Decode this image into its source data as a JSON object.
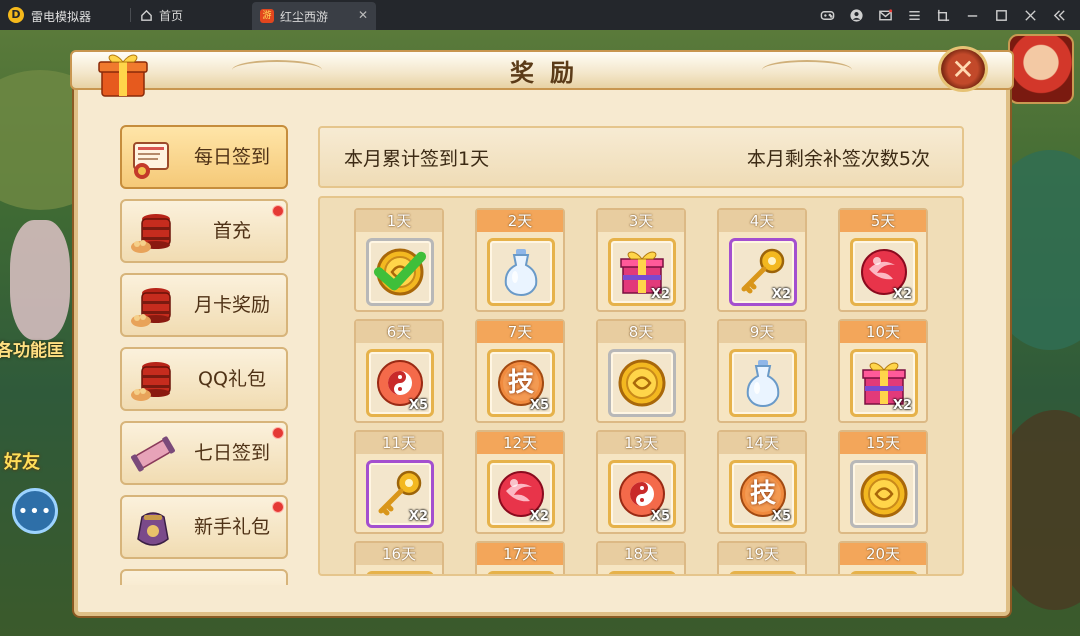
{
  "emulator": {
    "app_name": "雷电模拟器",
    "home_tab": "首页",
    "game_tab": "红尘西游",
    "logo_glyph": "D",
    "game_glyph": "游"
  },
  "scene": {
    "left_text": "各功能匡",
    "hao_text": "好友",
    "chat_glyph": "•••"
  },
  "panel": {
    "title": "奖励",
    "close_glyph": "✕",
    "menu": [
      {
        "label": "每日签到",
        "icon": "scroll-icon",
        "active": true,
        "red_dot": false
      },
      {
        "label": "首充",
        "icon": "treasure-basket-icon",
        "active": false,
        "red_dot": true
      },
      {
        "label": "月卡奖励",
        "icon": "treasure-basket-icon",
        "active": false,
        "red_dot": false
      },
      {
        "label": "QQ礼包",
        "icon": "treasure-basket-icon",
        "active": false,
        "red_dot": false
      },
      {
        "label": "七日签到",
        "icon": "scroll-roll-icon",
        "active": false,
        "red_dot": true
      },
      {
        "label": "新手礼包",
        "icon": "pouch-icon",
        "active": false,
        "red_dot": true
      }
    ],
    "info": {
      "signed": "本月累计签到1天",
      "remaining": "本月剩余补签次数5次"
    },
    "days": [
      {
        "day": "1天",
        "item": "gold-coin-icon",
        "frame": "silver",
        "qty": "",
        "claimed": true,
        "header": "tan"
      },
      {
        "day": "2天",
        "item": "potion-bottle-icon",
        "frame": "gold",
        "qty": "",
        "claimed": false,
        "header": "orange"
      },
      {
        "day": "3天",
        "item": "gift-box-icon",
        "frame": "gold",
        "qty": "X2",
        "claimed": false,
        "header": "tan"
      },
      {
        "day": "4天",
        "item": "golden-key-icon",
        "frame": "purple",
        "qty": "X2",
        "claimed": false,
        "header": "tan"
      },
      {
        "day": "5天",
        "item": "red-orb-icon",
        "frame": "gold",
        "qty": "X2",
        "claimed": false,
        "header": "orange"
      },
      {
        "day": "6天",
        "item": "yin-yang-orb-icon",
        "frame": "gold",
        "qty": "X5",
        "claimed": false,
        "header": "tan"
      },
      {
        "day": "7天",
        "item": "skill-orb-icon",
        "frame": "gold",
        "qty": "X5",
        "claimed": false,
        "header": "orange"
      },
      {
        "day": "8天",
        "item": "gold-coin-icon",
        "frame": "silver",
        "qty": "",
        "claimed": false,
        "header": "tan"
      },
      {
        "day": "9天",
        "item": "potion-bottle-icon",
        "frame": "gold",
        "qty": "",
        "claimed": false,
        "header": "tan"
      },
      {
        "day": "10天",
        "item": "gift-box-icon",
        "frame": "gold",
        "qty": "X2",
        "claimed": false,
        "header": "orange"
      },
      {
        "day": "11天",
        "item": "golden-key-icon",
        "frame": "purple",
        "qty": "X2",
        "claimed": false,
        "header": "tan"
      },
      {
        "day": "12天",
        "item": "red-orb-icon",
        "frame": "gold",
        "qty": "X2",
        "claimed": false,
        "header": "orange"
      },
      {
        "day": "13天",
        "item": "yin-yang-orb-icon",
        "frame": "gold",
        "qty": "X5",
        "claimed": false,
        "header": "tan"
      },
      {
        "day": "14天",
        "item": "skill-orb-icon",
        "frame": "gold",
        "qty": "X5",
        "claimed": false,
        "header": "tan"
      },
      {
        "day": "15天",
        "item": "gold-coin-icon",
        "frame": "silver",
        "qty": "",
        "claimed": false,
        "header": "orange"
      },
      {
        "day": "16天",
        "item": "",
        "frame": "gold",
        "qty": "",
        "claimed": false,
        "header": "tan"
      },
      {
        "day": "17天",
        "item": "",
        "frame": "gold",
        "qty": "",
        "claimed": false,
        "header": "orange"
      },
      {
        "day": "18天",
        "item": "",
        "frame": "gold",
        "qty": "",
        "claimed": false,
        "header": "tan"
      },
      {
        "day": "19天",
        "item": "",
        "frame": "gold",
        "qty": "",
        "claimed": false,
        "header": "tan"
      },
      {
        "day": "20天",
        "item": "",
        "frame": "gold",
        "qty": "",
        "claimed": false,
        "header": "orange"
      }
    ],
    "skill_glyph": "技"
  },
  "colors": {
    "accent_orange": "#f3a65a",
    "panel_bg": "#f7ead0",
    "red_dot": "#e53934"
  }
}
